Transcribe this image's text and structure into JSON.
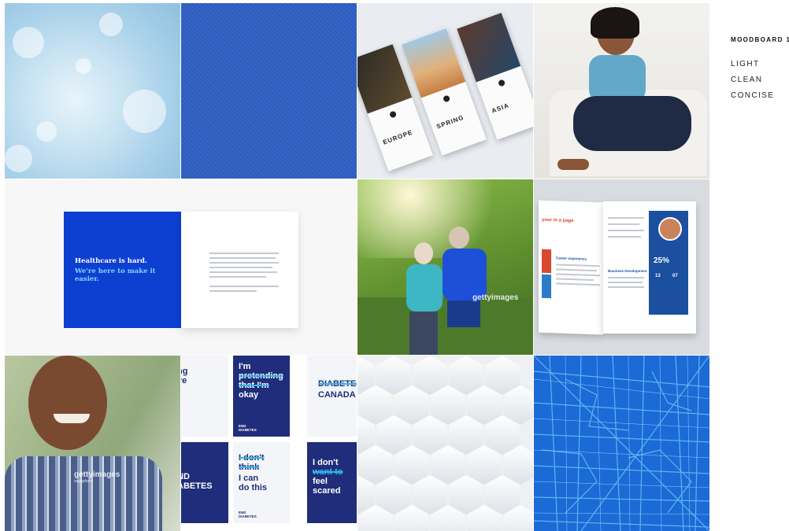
{
  "moodboard": {
    "title": "MOODBOARD 1",
    "keywords": [
      "LIGHT",
      "CLEAN",
      "CONCISE"
    ]
  },
  "brochures": {
    "titles": [
      "EUROPE",
      "SPRING",
      "ASIA"
    ]
  },
  "healthcare_card": {
    "headline": "Healthcare is hard.",
    "subline": "We're here to make it easier."
  },
  "watermarks": {
    "brand": "gettyimages",
    "credit": "sagaphoto"
  },
  "magazine": {
    "spread_title": "your in a page",
    "heading_left": "Career experience",
    "heading_right": "Business Development",
    "stat": "25%",
    "num_a": "13",
    "num_b": "07"
  },
  "posters": {
    "p1_text": "ng",
    "p1b_text": "ve",
    "p2_line1": "I'm",
    "p2_line2": "pretending",
    "p2_line3": "that I'm",
    "p2_line4": "okay",
    "p3_line1": "DIABETES",
    "p3_line2": "CANADA",
    "p4_line1": "ND",
    "p4_line2": "ABETES",
    "p5_line1": "I don't",
    "p5_line2": "think",
    "p5_line3": "I can",
    "p5_line4": "do this",
    "p6_line1": "I don't",
    "p6_line2": "want to",
    "p6_line3": "feel",
    "p6_line4": "scared",
    "footer_end": "END",
    "footer_diabetes": "DIABETES"
  },
  "colors": {
    "brand_blue": "#0d3fd1",
    "navy": "#1f2d7a",
    "accent_cyan": "#35b6e8",
    "map_blue": "#1c6ad6"
  }
}
